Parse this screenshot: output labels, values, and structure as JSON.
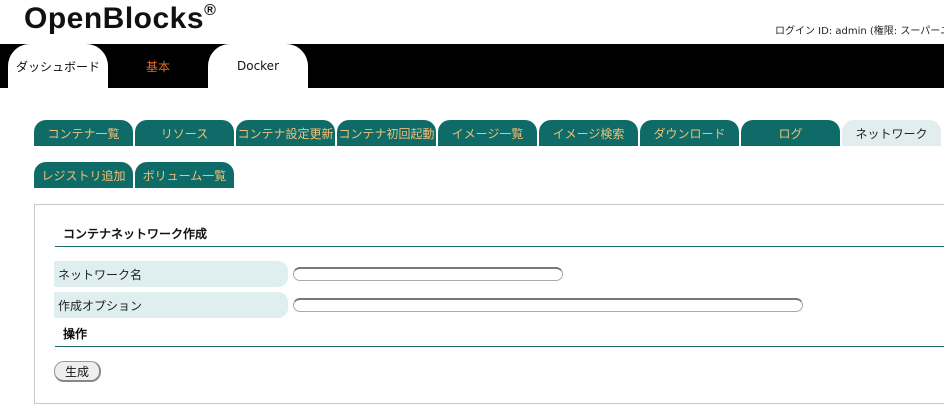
{
  "header": {
    "logo_text": "OpenBlocks",
    "logo_mark": "®",
    "login_info": "ログイン ID: admin (権限: スーパーユ"
  },
  "top_tabs": [
    {
      "label": "ダッシュボード",
      "active": true
    },
    {
      "label": "基本",
      "active": false
    },
    {
      "label": "Docker",
      "active": true
    }
  ],
  "sub_tabs": [
    {
      "label": "コンテナ一覧"
    },
    {
      "label": "リソース"
    },
    {
      "label": "コンテナ設定更新"
    },
    {
      "label": "コンテナ初回起動"
    },
    {
      "label": "イメージ一覧"
    },
    {
      "label": "イメージ検索"
    },
    {
      "label": "ダウンロード"
    },
    {
      "label": "ログ"
    },
    {
      "label": "ネットワーク",
      "active": true
    },
    {
      "label": "レジストリ追加"
    },
    {
      "label": "ボリューム一覧"
    }
  ],
  "form": {
    "title": "コンテナネットワーク作成",
    "fields": [
      {
        "label": "ネットワーク名",
        "value": ""
      },
      {
        "label": "作成オプション",
        "value": ""
      }
    ],
    "operation_title": "操作",
    "create_button": "生成"
  },
  "colors": {
    "top_bar": "#000000",
    "tab_teal": "#0f6b68",
    "tab_text": "#f0c078",
    "active_tab": "#e2eeee",
    "accent_orange": "#e86a1e"
  }
}
